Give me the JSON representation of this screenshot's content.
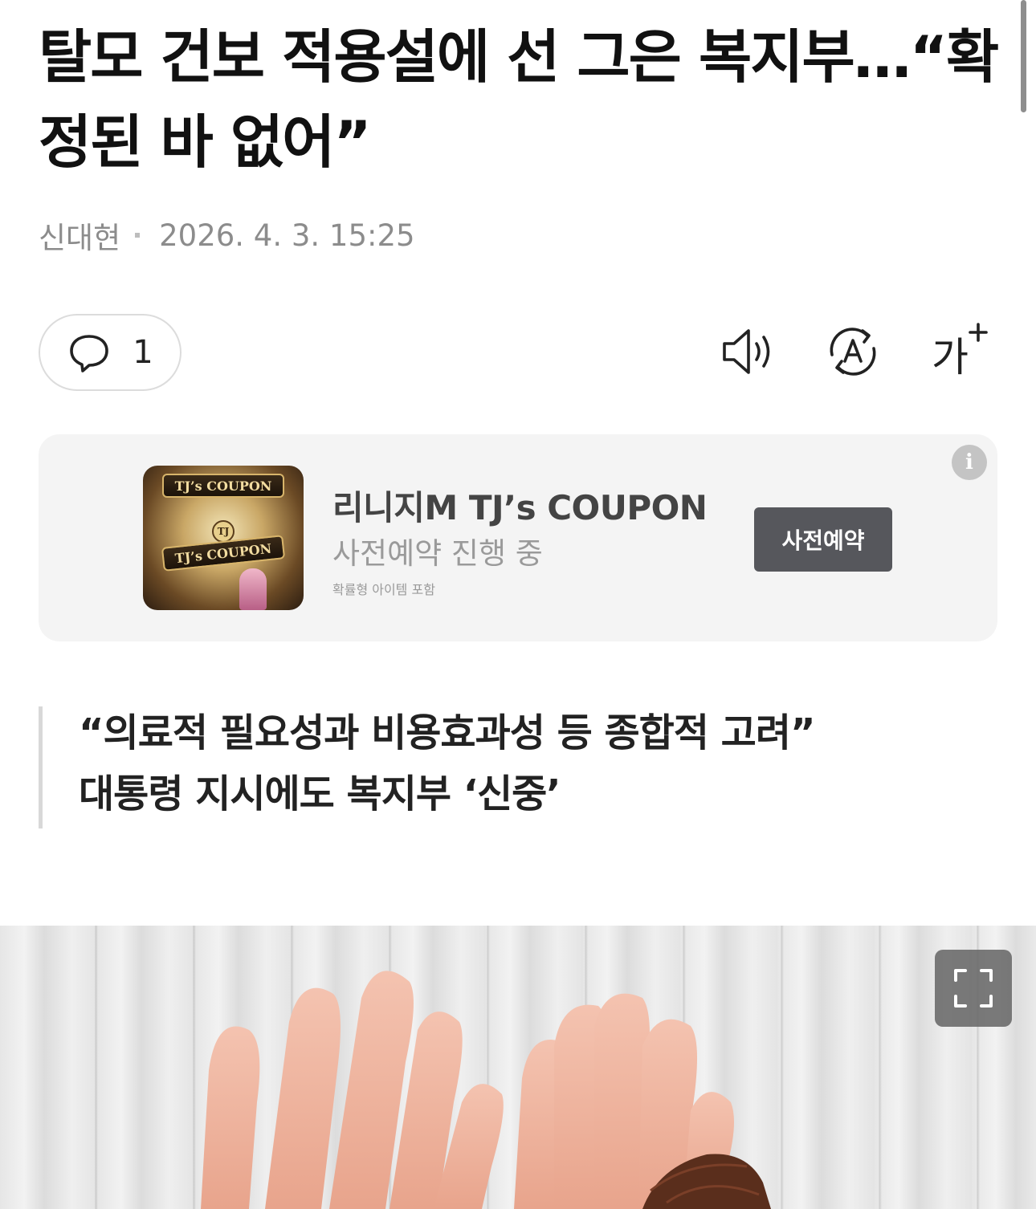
{
  "article": {
    "title": "탈모 건보 적용설에 선 그은 복지부…“확정된 바 없어”",
    "author": "신대현",
    "datetime": "2026. 4. 3. 15:25",
    "comment_count": "1",
    "summary_lines": [
      "“의료적 필요성과 비용효과성 등 종합적 고려”",
      "대통령 지시에도 복지부 ‘신중’"
    ]
  },
  "toolbar": {
    "icons": [
      "speaker-icon",
      "translate-icon",
      "font-size-icon"
    ],
    "font_size_glyph": "가"
  },
  "ad": {
    "title": "리니지M TJ’s COUPON",
    "subtitle": "사전예약 진행 중",
    "note": "확률형 아이템 포함",
    "cta_label": "사전예약",
    "info_glyph": "i",
    "thumb_text_top": "TJ’s COUPON",
    "thumb_text_bottom": "TJ’s COUPON",
    "thumb_seal": "TJ"
  },
  "image": {
    "expand_icon": "fullscreen-icon"
  },
  "colors": {
    "ad_background": "#f4f4f4",
    "ad_button": "#56575c",
    "meta_text": "#8c8c8c"
  }
}
